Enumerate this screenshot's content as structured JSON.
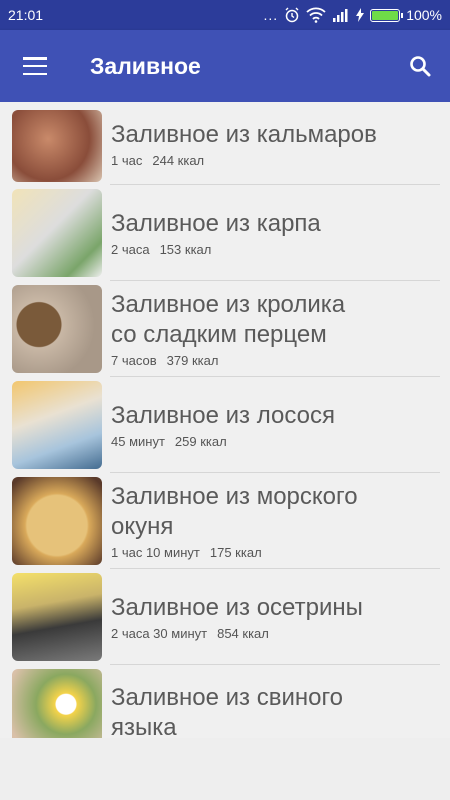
{
  "status_bar": {
    "time": "21:01",
    "dots": "...",
    "battery_percent": "100%",
    "icons": [
      "alarm-icon",
      "wifi-icon",
      "signal-icon",
      "charging-icon",
      "battery-icon"
    ]
  },
  "app_bar": {
    "title": "Заливное",
    "menu_icon": "hamburger-menu-icon",
    "search_icon": "search-icon",
    "color": "#3f51b5"
  },
  "recipes": [
    {
      "name": "Заливное из кальмаров",
      "time": "1 час",
      "kcal": "244 ккал"
    },
    {
      "name": "Заливное из карпа",
      "time": "2 часа",
      "kcal": "153 ккал"
    },
    {
      "name_line1": "Заливное из кролика",
      "name_line2": "со сладким перцем",
      "time": "7 часов",
      "kcal": "379 ккал"
    },
    {
      "name": "Заливное из лосося",
      "time": "45 минут",
      "kcal": "259 ккал"
    },
    {
      "name_line1": "Заливное из морского",
      "name_line2": "окуня",
      "time": "1 час 10 минут",
      "kcal": "175 ккал"
    },
    {
      "name": "Заливное из осетрины",
      "time": "2 часа 30 минут",
      "kcal": "854 ккал"
    },
    {
      "name_line1": "Заливное из свиного",
      "name_line2": "языка"
    }
  ]
}
